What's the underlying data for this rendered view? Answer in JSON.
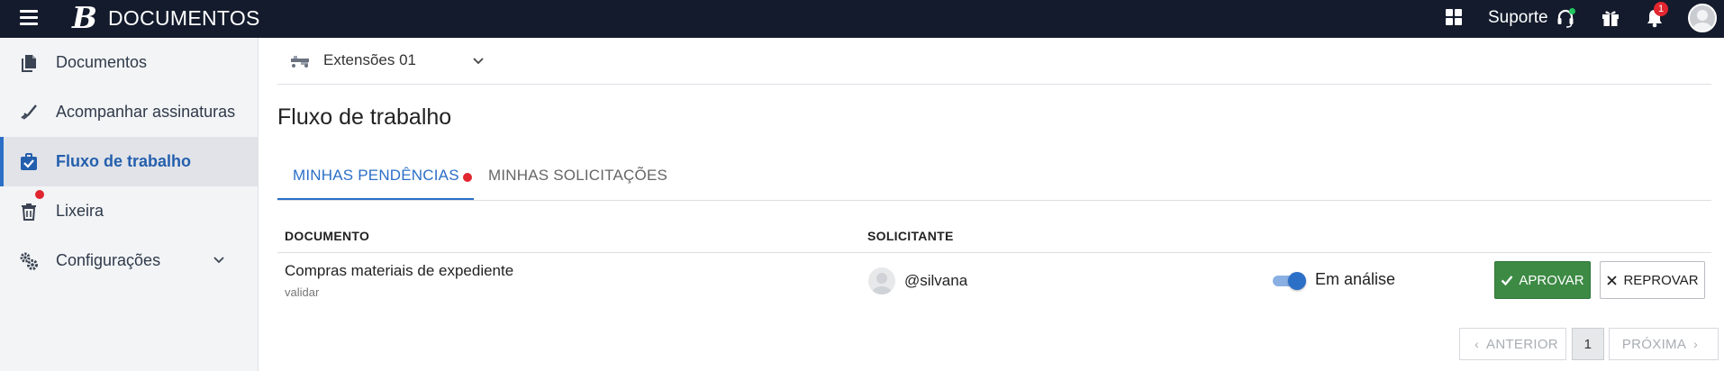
{
  "topbar": {
    "app_name": "DOCUMENTOS",
    "logo_letter": "B",
    "support_label": "Suporte",
    "notifications_count": "1",
    "colors": {
      "background": "#141b2d",
      "badge": "#e1262f",
      "online": "#22c55e"
    }
  },
  "sidebar": {
    "items": [
      {
        "label": "Documentos",
        "icon": "documents-icon"
      },
      {
        "label": "Acompanhar assinaturas",
        "icon": "signature-icon"
      },
      {
        "label": "Fluxo de trabalho",
        "icon": "workflow-icon",
        "active": true
      },
      {
        "label": "Lixeira",
        "icon": "trash-icon"
      },
      {
        "label": "Configurações",
        "icon": "settings-icon"
      }
    ]
  },
  "main": {
    "extension_select": {
      "value": "Extensões 01"
    },
    "page_title": "Fluxo de trabalho",
    "tabs": [
      {
        "label": "MINHAS PENDÊNCIAS",
        "active": true
      },
      {
        "label": "MINHAS SOLICITAÇÕES"
      }
    ],
    "table": {
      "columns": [
        "DOCUMENTO",
        "SOLICITANTE"
      ],
      "rows": [
        {
          "document": "Compras materiais de expediente",
          "document_sub": "validar",
          "requester": "@silvana",
          "status": "Em análise",
          "status_on": true
        }
      ]
    },
    "actions": {
      "approve": "APROVAR",
      "reject": "REPROVAR"
    },
    "pagination": {
      "prev": "ANTERIOR",
      "page": "1",
      "next": "PRÓXIMA"
    },
    "colors": {
      "accent": "#2b6fc7",
      "approve": "#3d8a45"
    }
  }
}
